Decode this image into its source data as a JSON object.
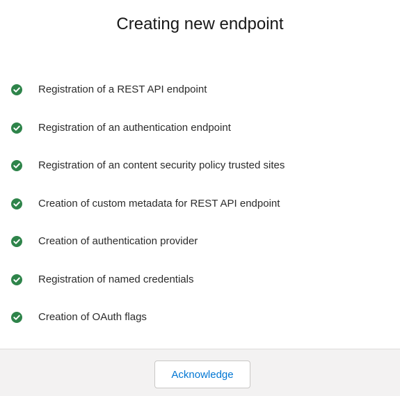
{
  "modal": {
    "title": "Creating new endpoint",
    "status_color": "#2e844a",
    "steps": [
      {
        "label": "Registration of a REST API endpoint",
        "status": "complete",
        "icon": "check-circle-icon"
      },
      {
        "label": "Registration of an authentication endpoint",
        "status": "complete",
        "icon": "check-circle-icon"
      },
      {
        "label": "Registration of an content security policy trusted sites",
        "status": "complete",
        "icon": "check-circle-icon"
      },
      {
        "label": "Creation of custom metadata for REST API endpoint",
        "status": "complete",
        "icon": "check-circle-icon"
      },
      {
        "label": "Creation of authentication provider",
        "status": "complete",
        "icon": "check-circle-icon"
      },
      {
        "label": "Registration of named credentials",
        "status": "complete",
        "icon": "check-circle-icon"
      },
      {
        "label": "Creation of OAuth flags",
        "status": "complete",
        "icon": "check-circle-icon"
      }
    ],
    "footer": {
      "acknowledge_label": "Acknowledge",
      "button_text_color": "#0176d3"
    }
  }
}
